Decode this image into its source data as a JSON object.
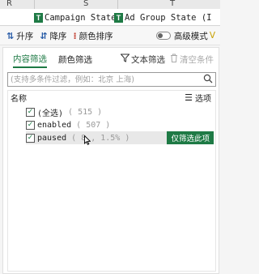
{
  "columns": [
    "R",
    "S",
    "T"
  ],
  "headers": [
    {
      "icon": "T",
      "text": "Campaign State"
    },
    {
      "icon": "T",
      "text": "Ad Group State (I"
    }
  ],
  "toolbar": {
    "sort_asc": "升序",
    "sort_desc": "降序",
    "color_sort": "颜色排序",
    "advanced_mode": "高级模式",
    "advanced_mode_on": false
  },
  "tabs": {
    "content_filter": "内容筛选",
    "color_filter": "颜色筛选",
    "text_filter": "文本筛选",
    "clear_filter": "清空条件"
  },
  "search": {
    "placeholder": "(支持多条件过滤，例如：北京 上海)"
  },
  "list": {
    "name_label": "名称",
    "options_label": "选项",
    "items": [
      {
        "label": "(全选)",
        "count": "( 515 )",
        "checked": true
      },
      {
        "label": "enabled",
        "count": "( 507 )",
        "checked": true
      },
      {
        "label": "paused",
        "count": "( 8 , 1.5% )",
        "checked": true
      }
    ],
    "only_filter_badge": "仅筛选此项"
  },
  "colors": {
    "accent": "#1e7a45",
    "brand_blue": "#2a5da8"
  }
}
